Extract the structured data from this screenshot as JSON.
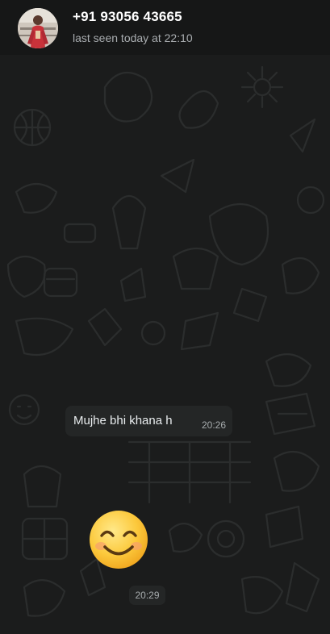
{
  "header": {
    "contact_name": "+91 93056 43665",
    "last_seen": "last seen today at 22:10"
  },
  "messages": [
    {
      "type": "text",
      "text": "Mujhe bhi khana h",
      "time": "20:26"
    },
    {
      "type": "emoji",
      "emoji_name": "smiling-face-with-smiling-eyes",
      "time": "20:29"
    }
  ],
  "colors": {
    "background": "#161717",
    "chat_background": "#1b1c1c",
    "bubble": "#242626",
    "primary_text": "#ffffff",
    "secondary_text": "#a9adb0"
  }
}
